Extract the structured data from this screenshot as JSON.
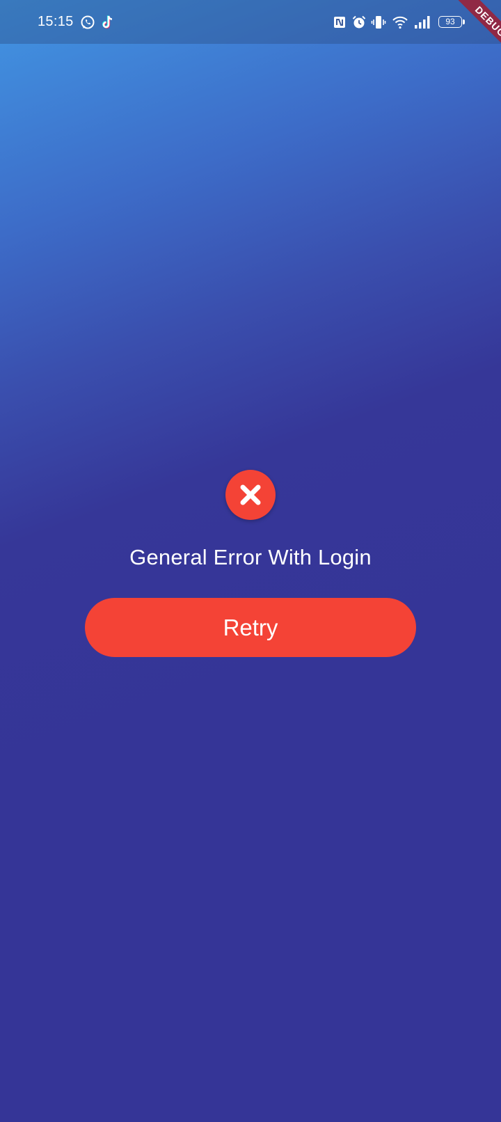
{
  "status_bar": {
    "time": "15:15",
    "battery_level": "93",
    "left_icons": [
      "whatsapp-icon",
      "tiktok-icon"
    ],
    "right_icons": [
      "nfc-icon",
      "alarm-icon",
      "vibrate-icon",
      "wifi-icon",
      "signal-icon",
      "battery-icon"
    ]
  },
  "debug_banner": {
    "label": "DEBUG"
  },
  "error": {
    "icon": "error-x-icon",
    "message": "General Error With Login"
  },
  "actions": {
    "retry_label": "Retry"
  },
  "colors": {
    "gradient_top": "#4296e3",
    "gradient_bottom": "#353597",
    "error_red": "#f44336",
    "text": "#ffffff",
    "debug_ribbon": "#a01e32"
  }
}
